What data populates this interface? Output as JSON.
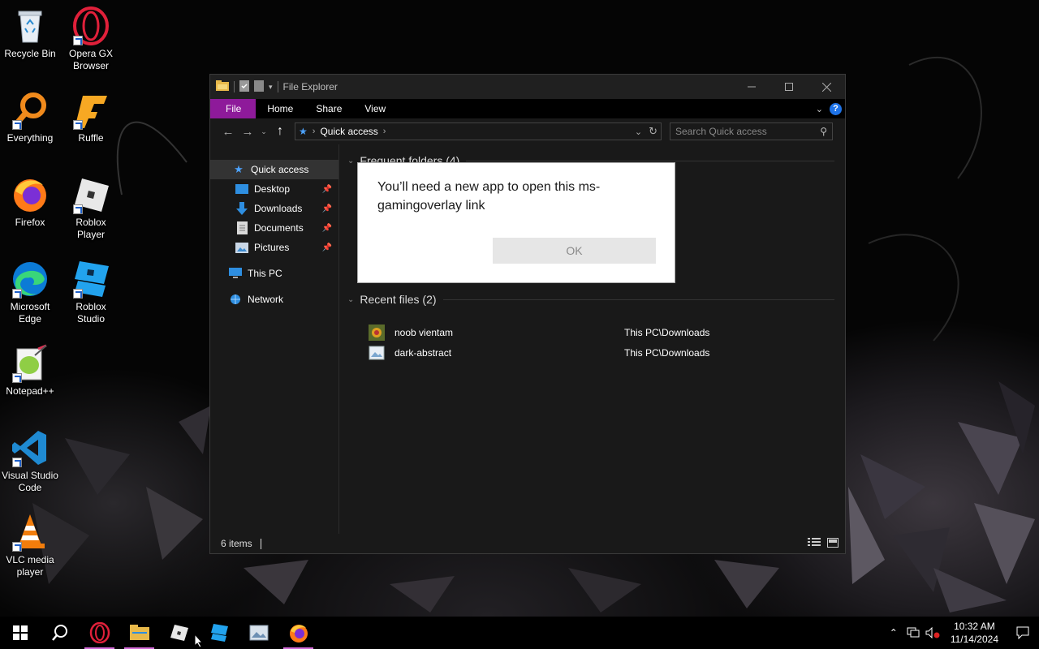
{
  "desktop": {
    "icons": [
      {
        "label": "Recycle Bin",
        "icon": "recycle-bin-icon"
      },
      {
        "label": "Opera GX Browser",
        "icon": "opera-gx-icon"
      },
      {
        "label": "Everything",
        "icon": "everything-search-icon"
      },
      {
        "label": "Ruffle",
        "icon": "ruffle-icon"
      },
      {
        "label": "Firefox",
        "icon": "firefox-icon"
      },
      {
        "label": "Roblox Player",
        "icon": "roblox-player-icon"
      },
      {
        "label": "Microsoft Edge",
        "icon": "edge-icon"
      },
      {
        "label": "Roblox Studio",
        "icon": "roblox-studio-icon"
      },
      {
        "label": "Notepad++",
        "icon": "notepad-plus-plus-icon"
      },
      {
        "label": "Visual Studio Code",
        "icon": "vscode-icon"
      },
      {
        "label": "VLC media player",
        "icon": "vlc-icon"
      }
    ]
  },
  "explorer": {
    "title": "File Explorer",
    "tabs": {
      "file": "File",
      "home": "Home",
      "share": "Share",
      "view": "View"
    },
    "address": {
      "location": "Quick access"
    },
    "search": {
      "placeholder": "Search Quick access"
    },
    "nav": {
      "quick_access": "Quick access",
      "desktop": "Desktop",
      "downloads": "Downloads",
      "documents": "Documents",
      "pictures": "Pictures",
      "this_pc": "This PC",
      "network": "Network"
    },
    "groups": {
      "frequent": "Frequent folders (4)",
      "recent": "Recent files (2)"
    },
    "recent_files": [
      {
        "name": "noob vientam",
        "location": "This PC\\Downloads"
      },
      {
        "name": "dark-abstract",
        "location": "This PC\\Downloads"
      }
    ],
    "status": {
      "items": "6 items"
    }
  },
  "dialog": {
    "message": "You’ll need a new app to open this ms-gamingoverlay link",
    "ok_label": "OK"
  },
  "taskbar": {
    "time": "10:32 AM",
    "date": "11/14/2024"
  },
  "colors": {
    "file_tab": "#8e1a9a",
    "accent_blue": "#1e73e8",
    "taskbar_underline": "#d36ad8"
  }
}
